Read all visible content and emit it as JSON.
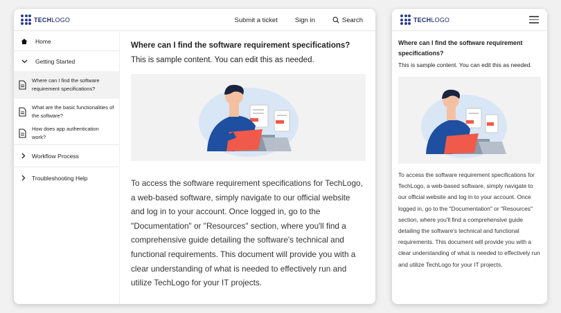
{
  "brand": {
    "logo_bold": "TECH",
    "logo_rest": "LOGO"
  },
  "header": {
    "submit_ticket": "Submit a ticket",
    "sign_in": "Sign in",
    "search": "Search"
  },
  "sidebar": {
    "home": "Home",
    "getting_started": "Getting Started",
    "articles": [
      "Where can I find the software requirement specifications?",
      "What are the basic functionalities of the software?",
      "How does app authentication work?"
    ],
    "workflow": "Workflow Process",
    "troubleshooting": "Troubleshooting Help"
  },
  "article": {
    "title": "Where can I find the software requirement specifications?",
    "intro": "This is sample content. You can edit this as needed.",
    "answer": "To access the software requirement specifications for TechLogo, a web-based software, simply navigate to our official website and log in to your account. Once logged in, go to the \"Documentation\" or \"Resources\" section, where you'll find a comprehensive guide detailing the software's technical and functional requirements. This document will provide you with a clear understanding of what is needed to effectively run and utilize TechLogo for your IT projects."
  },
  "colors": {
    "brand": "#2b3a8c",
    "illustration_blue": "#1f4fa0",
    "laptop_red": "#f05a4a"
  }
}
